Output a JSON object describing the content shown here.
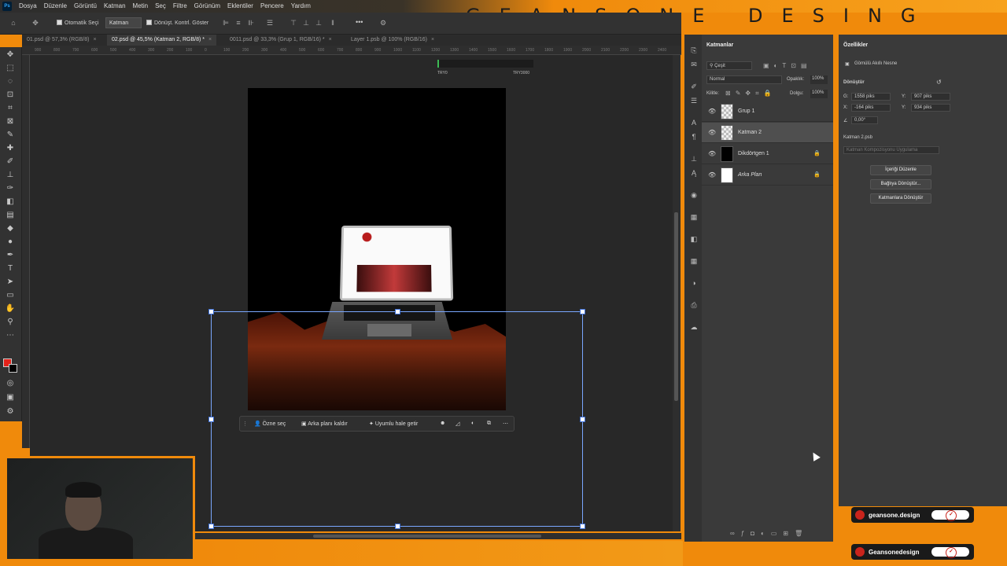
{
  "app": {
    "logo": "Ps"
  },
  "menubar": {
    "items": [
      "Dosya",
      "Düzenle",
      "Görüntü",
      "Katman",
      "Metin",
      "Seç",
      "Filtre",
      "Görünüm",
      "Eklentiler",
      "Pencere",
      "Yardım"
    ]
  },
  "brand": {
    "text": "GEANSONE DESING"
  },
  "options": {
    "auto_select": "Otomatik Seçi",
    "target": "Katman",
    "transform_controls": "Dönüşt. Kontrl. Göster",
    "more": "•••"
  },
  "tabs": [
    {
      "label": "01.psd @ 57,3% (RGB/8)"
    },
    {
      "label": "02.psd @ 45,5% (Katman 2, RGB/8) *"
    },
    {
      "label": "0011.psd @ 33,3% (Grup 1, RGB/16) *"
    },
    {
      "label": "Layer 1.psb @ 100% (RGB/16)"
    }
  ],
  "ruler": {
    "ticks": [
      "900",
      "800",
      "700",
      "600",
      "500",
      "400",
      "300",
      "200",
      "100",
      "0",
      "100",
      "200",
      "300",
      "400",
      "500",
      "600",
      "700",
      "800",
      "900",
      "1000",
      "1100",
      "1200",
      "1300",
      "1400",
      "1500",
      "1600",
      "1700",
      "1800",
      "1900",
      "2000",
      "2100",
      "2200",
      "2300",
      "2400"
    ]
  },
  "nav": {
    "left": "TRY0",
    "right": "TRY3000"
  },
  "context_bar": {
    "select_subject": "Özne seç",
    "remove_bg": "Arka planı kaldır",
    "harmonize": "Uyumlu hale getir"
  },
  "layers_panel": {
    "title": "Katmanlar",
    "filter": "Çeşit",
    "blend_mode": "Normal",
    "opacity_label": "Opaklık:",
    "opacity_value": "100%",
    "lock_label": "Kilitle:",
    "fill_label": "Dolgu:",
    "fill_value": "100%",
    "layers": [
      {
        "name": "Grup 1",
        "locked": false,
        "selected": false
      },
      {
        "name": "Katman 2",
        "locked": false,
        "selected": true
      },
      {
        "name": "Dikdörtgen 1",
        "locked": true,
        "selected": false
      },
      {
        "name": "Arka Plan",
        "locked": true,
        "selected": false
      }
    ]
  },
  "properties_panel": {
    "title": "Özellikler",
    "object_type": "Gömülü Akıllı Nesne",
    "section": "Dönüştür",
    "w_label": "G:",
    "w_value": "1558 piks",
    "h_label": "Y:",
    "h_value": "907 piks",
    "x_label": "X:",
    "x_value": "-164 piks",
    "y_label": "Y:",
    "y_value": "934 piks",
    "angle_value": "0,00°",
    "file_name": "Katman 2.psb",
    "comp_placeholder": "Katman Kompozisyonu Uygulama",
    "btn_edit": "İçeriği Düzenle",
    "btn_convert_linked": "Bağlıya Dönüştür...",
    "btn_convert_layers": "Katmanlara Dönüştür"
  },
  "badges": {
    "top": "geansone.design",
    "bottom": "Geansonedesign"
  },
  "colors": {
    "accent": "#f08a0b",
    "panel": "#3a3a3a",
    "selection": "#7aa7ff"
  }
}
